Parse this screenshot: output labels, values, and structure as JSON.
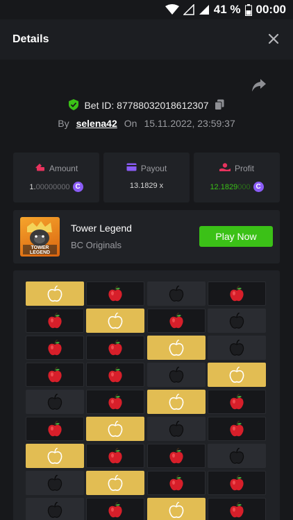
{
  "status_bar": {
    "battery": "41 %",
    "time": "00:00"
  },
  "header": {
    "title": "Details"
  },
  "bet": {
    "id_label": "Bet ID: 87788032018612307",
    "by_label": "By",
    "username": "selena42",
    "on_label": "On",
    "datetime": "15.11.2022, 23:59:37"
  },
  "stats": [
    {
      "label": "Amount",
      "value_main": "1.",
      "value_dim": "00000000",
      "icon": "wallet-icon",
      "color": "#e8335e"
    },
    {
      "label": "Payout",
      "value_main": "13.1829 x",
      "value_dim": "",
      "icon": "card-icon",
      "color": "#8a5cf6"
    },
    {
      "label": "Profit",
      "value_main": "12.1829",
      "value_dim": "000",
      "icon": "profit-icon",
      "color": "#e8335e"
    }
  ],
  "game": {
    "name": "Tower Legend",
    "provider": "BC Originals",
    "play_label": "Play Now",
    "thumb_text": "TOWER LEGEND"
  },
  "board": {
    "rows": [
      [
        "gold",
        "red",
        "bomb",
        "red"
      ],
      [
        "red",
        "gold",
        "red",
        "bomb"
      ],
      [
        "red",
        "red",
        "gold",
        "bomb"
      ],
      [
        "red",
        "red",
        "bomb",
        "gold"
      ],
      [
        "bomb",
        "red",
        "gold",
        "red"
      ],
      [
        "red",
        "gold",
        "bomb",
        "red"
      ],
      [
        "gold",
        "red",
        "red",
        "bomb"
      ],
      [
        "bomb",
        "gold",
        "red",
        "red"
      ],
      [
        "bomb",
        "red",
        "gold",
        "red"
      ]
    ]
  },
  "colors": {
    "accent_green": "#3bc117",
    "profit_green": "#3bc117",
    "coin_purple": "#8a5cf6"
  }
}
